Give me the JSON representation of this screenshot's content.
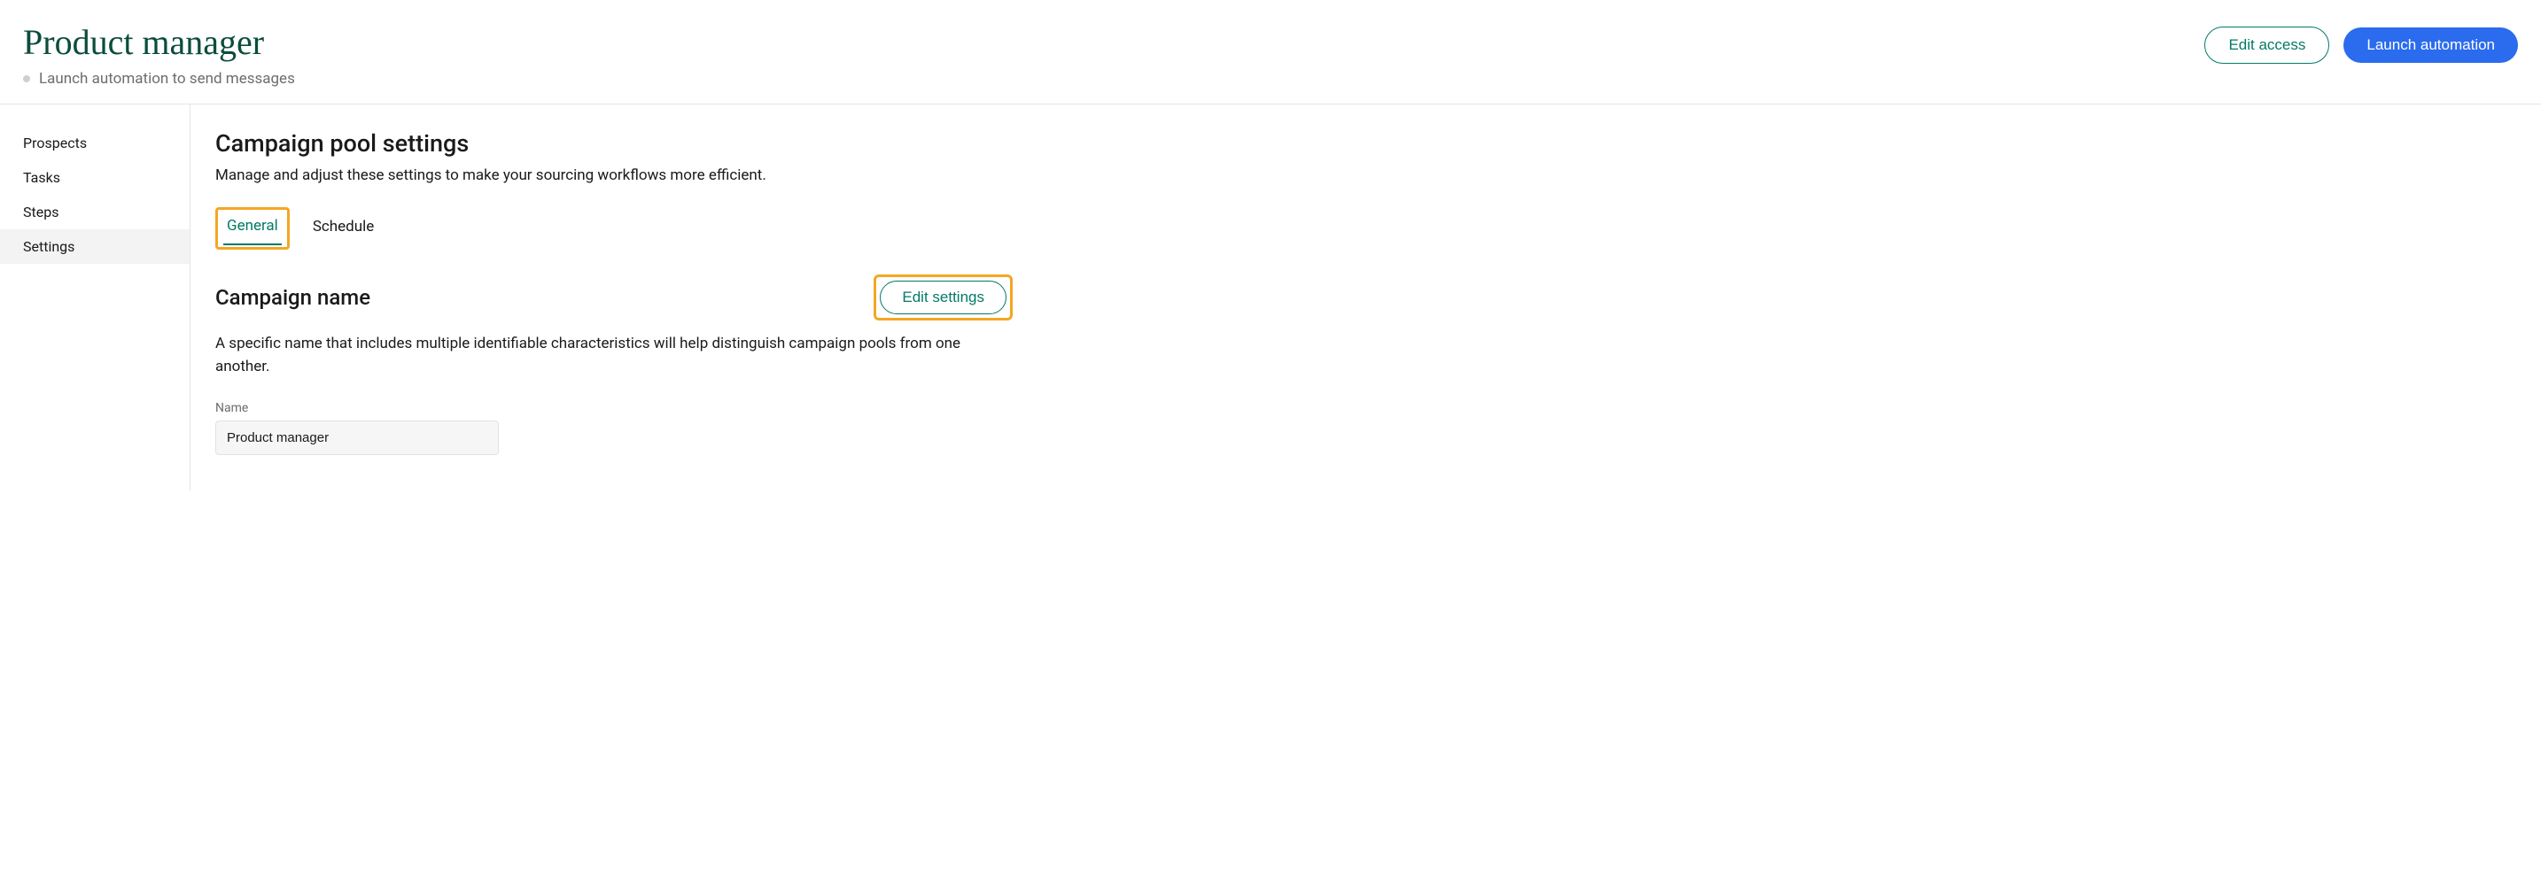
{
  "header": {
    "title": "Product manager",
    "status_text": "Launch automation to send messages",
    "edit_access_label": "Edit access",
    "launch_label": "Launch automation"
  },
  "sidebar": {
    "items": [
      {
        "label": "Prospects",
        "active": false
      },
      {
        "label": "Tasks",
        "active": false
      },
      {
        "label": "Steps",
        "active": false
      },
      {
        "label": "Settings",
        "active": true
      }
    ]
  },
  "main": {
    "settings_title": "Campaign pool settings",
    "settings_desc": "Manage and adjust these settings to make your sourcing workflows more efficient.",
    "tabs": [
      {
        "label": "General",
        "active": true
      },
      {
        "label": "Schedule",
        "active": false
      }
    ],
    "campaign_name": {
      "heading": "Campaign name",
      "edit_button": "Edit settings",
      "description": "A specific name that includes multiple identifiable characteristics will help distinguish campaign pools from one another.",
      "field_label": "Name",
      "field_value": "Product manager"
    }
  }
}
